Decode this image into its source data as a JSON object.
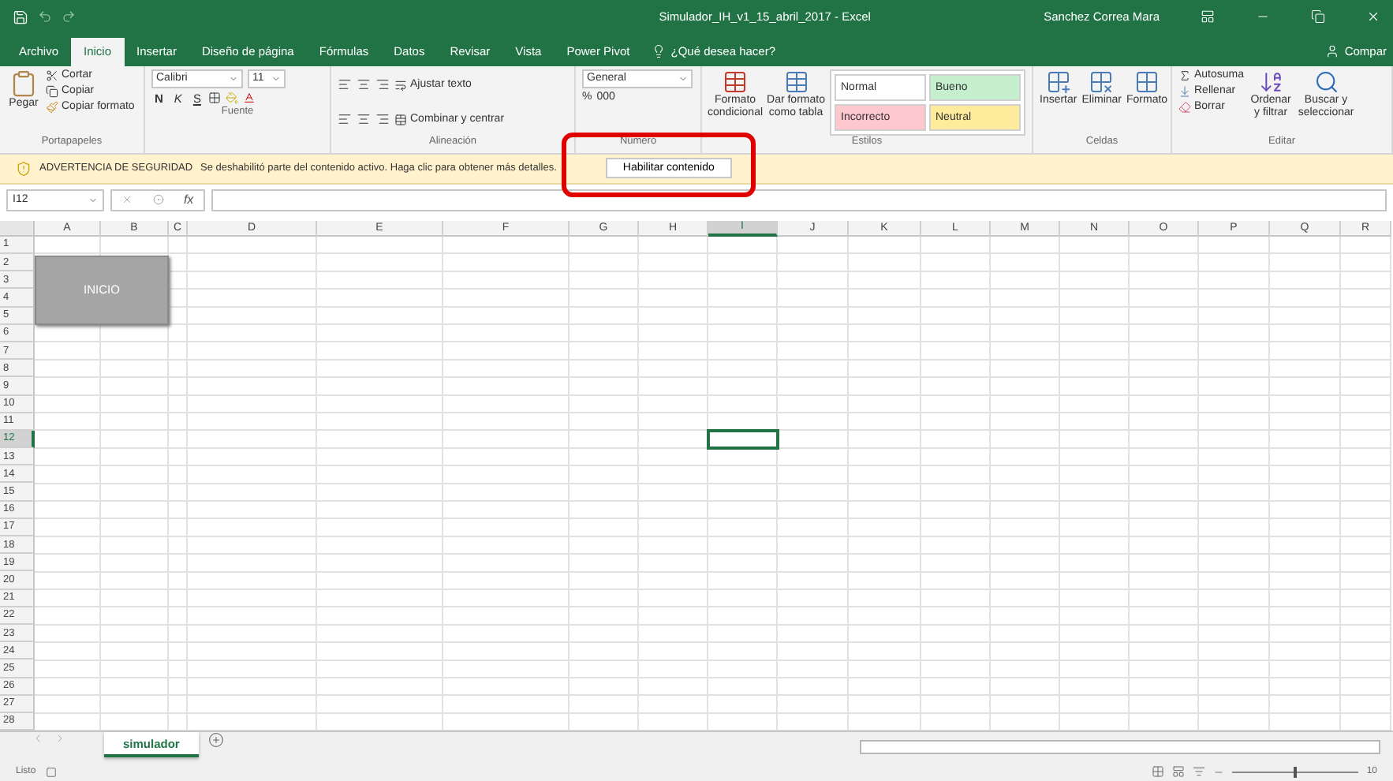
{
  "window": {
    "title": "Simulador_IH_v1_15_abril_2017  -  Excel",
    "user": "Sanchez Correa Mara"
  },
  "tabs": [
    {
      "label": "Archivo",
      "selected": false
    },
    {
      "label": "Inicio",
      "selected": true
    },
    {
      "label": "Insertar",
      "selected": false
    },
    {
      "label": "Diseño de página",
      "selected": false
    },
    {
      "label": "Fórmulas",
      "selected": false
    },
    {
      "label": "Datos",
      "selected": false
    },
    {
      "label": "Revisar",
      "selected": false
    },
    {
      "label": "Vista",
      "selected": false
    },
    {
      "label": "Power Pivot",
      "selected": false
    }
  ],
  "tell_me": {
    "placeholder": "¿Qué desea hacer?"
  },
  "share": {
    "label": "Compar"
  },
  "ribbon": {
    "clipboard": {
      "label": "Portapapeles",
      "paste": "Pegar",
      "cut": "Cortar",
      "copy": "Copiar",
      "format_painter": "Copiar formato"
    },
    "font": {
      "label": "Fuente",
      "name": "Calibri",
      "size": "11",
      "bold": "N",
      "italic": "K",
      "underline": "S"
    },
    "alignment": {
      "label": "Alineación",
      "wrap": "Ajustar texto",
      "merge": "Combinar y centrar"
    },
    "number": {
      "label": "Número",
      "format": "General",
      "percent": "%",
      "thousands": "000"
    },
    "styles": {
      "label": "Estilos",
      "conditional": "Formato condicional",
      "as_table": "Dar formato como tabla",
      "cells": [
        {
          "label": "Normal",
          "color": "#ffffff"
        },
        {
          "label": "Bueno",
          "color": "#c6efce"
        },
        {
          "label": "Incorrecto",
          "color": "#ffc7ce"
        },
        {
          "label": "Neutral",
          "color": "#ffeb9c"
        }
      ]
    },
    "cells": {
      "label": "Celdas",
      "buttons": [
        "Insertar",
        "Eliminar",
        "Formato"
      ]
    },
    "editing": {
      "label": "Editar",
      "autosum": "Autosuma",
      "fill": "Rellenar",
      "clear": "Borrar",
      "sort": "Ordenar y filtrar",
      "find": "Buscar y seleccionar"
    }
  },
  "security_bar": {
    "title": "ADVERTENCIA DE SEGURIDAD",
    "message": "Se deshabilitó parte del contenido activo. Haga clic para obtener más detalles.",
    "button": "Habilitar contenido",
    "highlighted": true
  },
  "formula_bar": {
    "name_box": "I12",
    "fx": "fx"
  },
  "columns": [
    {
      "label": "A",
      "selected": false
    },
    {
      "label": "B",
      "selected": false
    },
    {
      "label": "C",
      "selected": false
    },
    {
      "label": "D",
      "selected": false
    },
    {
      "label": "E",
      "selected": false
    },
    {
      "label": "F",
      "selected": false
    },
    {
      "label": "G",
      "selected": false
    },
    {
      "label": "H",
      "selected": false
    },
    {
      "label": "I",
      "selected": true
    },
    {
      "label": "J",
      "selected": false
    },
    {
      "label": "K",
      "selected": false
    },
    {
      "label": "L",
      "selected": false
    },
    {
      "label": "M",
      "selected": false
    },
    {
      "label": "N",
      "selected": false
    },
    {
      "label": "O",
      "selected": false
    },
    {
      "label": "P",
      "selected": false
    },
    {
      "label": "Q",
      "selected": false
    },
    {
      "label": "R",
      "selected": false
    }
  ],
  "rows": [
    {
      "label": "1",
      "selected": false
    },
    {
      "label": "2",
      "selected": false
    },
    {
      "label": "3",
      "selected": false
    },
    {
      "label": "4",
      "selected": false
    },
    {
      "label": "5",
      "selected": false
    },
    {
      "label": "6",
      "selected": false
    },
    {
      "label": "7",
      "selected": false
    },
    {
      "label": "8",
      "selected": false
    },
    {
      "label": "9",
      "selected": false
    },
    {
      "label": "10",
      "selected": false
    },
    {
      "label": "11",
      "selected": false
    },
    {
      "label": "12",
      "selected": true
    },
    {
      "label": "13",
      "selected": false
    },
    {
      "label": "14",
      "selected": false
    },
    {
      "label": "15",
      "selected": false
    },
    {
      "label": "16",
      "selected": false
    },
    {
      "label": "17",
      "selected": false
    },
    {
      "label": "18",
      "selected": false
    },
    {
      "label": "19",
      "selected": false
    },
    {
      "label": "20",
      "selected": false
    },
    {
      "label": "21",
      "selected": false
    },
    {
      "label": "22",
      "selected": false
    },
    {
      "label": "23",
      "selected": false
    },
    {
      "label": "24",
      "selected": false
    },
    {
      "label": "25",
      "selected": false
    },
    {
      "label": "26",
      "selected": false
    },
    {
      "label": "27",
      "selected": false
    },
    {
      "label": "28",
      "selected": false
    }
  ],
  "shape": {
    "text": "INICIO"
  },
  "sheets": [
    {
      "label": "simulador",
      "selected": true
    }
  ],
  "status_bar": {
    "status": "Listo",
    "zoom": "10",
    "level": 0.5
  }
}
